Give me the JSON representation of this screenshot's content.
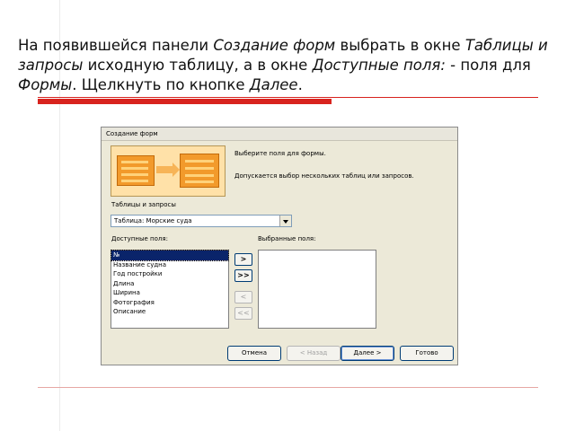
{
  "slide": {
    "text_parts": [
      {
        "t": "На появившейся панели ",
        "i": false
      },
      {
        "t": "Создание форм",
        "i": true
      },
      {
        "t": " выбрать в окне ",
        "i": false
      },
      {
        "t": "Таблицы и запросы",
        "i": true
      },
      {
        "t": " исходную таблицу, а в окне ",
        "i": false
      },
      {
        "t": "Доступные поля:",
        "i": true
      },
      {
        "t": " - поля для ",
        "i": false
      },
      {
        "t": "Формы",
        "i": true
      },
      {
        "t": ". Щелкнуть по кнопке ",
        "i": false
      },
      {
        "t": "Далее",
        "i": true
      },
      {
        "t": ".",
        "i": false
      }
    ]
  },
  "dialog": {
    "title": "Создание форм",
    "intro_line1": "Выберите поля для формы.",
    "intro_line2": "Допускается выбор нескольких таблиц или запросов.",
    "tables_label": "Таблицы и запросы",
    "tables_value": "Таблица: Морские суда",
    "available_label": "Доступные поля:",
    "chosen_label": "Выбранные поля:",
    "available_fields": [
      "№",
      "Название судна",
      "Год постройки",
      "Длина",
      "Ширина",
      "Фотография",
      "Описание"
    ],
    "chosen_fields": [],
    "move_buttons": {
      "add_one": ">",
      "add_all": ">>",
      "remove_one": "<",
      "remove_all": "<<"
    },
    "buttons": {
      "cancel": "Отмена",
      "back": "< Назад",
      "next": "Далее >",
      "finish": "Готово"
    }
  }
}
